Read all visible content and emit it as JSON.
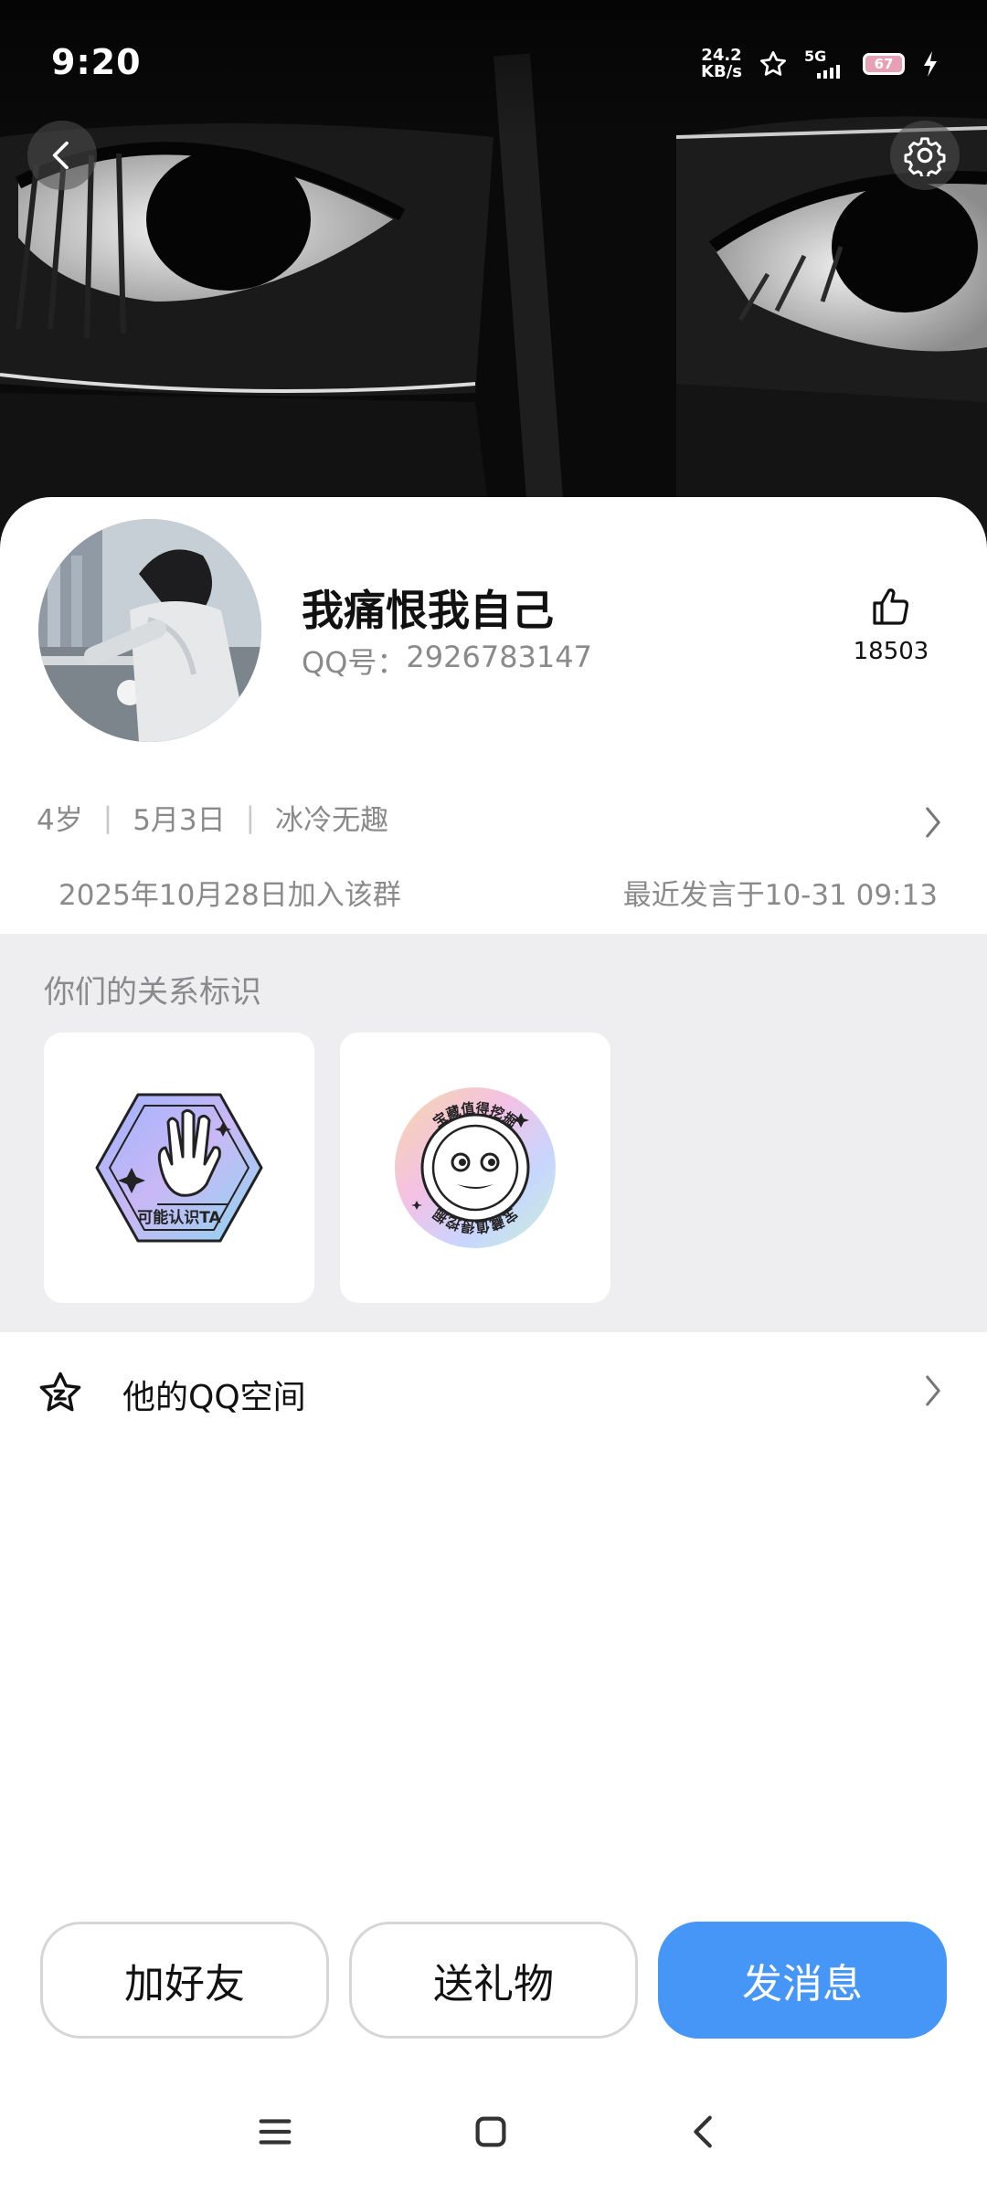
{
  "status_bar": {
    "time": "9:20",
    "net_speed_value": "24.2",
    "net_speed_unit": "KB/s",
    "network": "5G",
    "battery": "67",
    "icons": [
      "star-icon",
      "signal-icon",
      "battery-icon",
      "charging-icon"
    ]
  },
  "header": {
    "back_icon": "chevron-left-icon",
    "settings_icon": "gear-icon"
  },
  "profile": {
    "nickname": "我痛恨我自己",
    "qq_label": "QQ号：",
    "qq_number": "2926783147",
    "like_count": "18503",
    "like_icon": "thumbs-up-icon",
    "age": "4岁",
    "birthday": "5月3日",
    "signature": "冰冷无趣",
    "joined": "2025年10月28日加入该群",
    "last_speak": "最近发言于10-31 09:13"
  },
  "relation": {
    "title": "你们的关系标识",
    "badges": [
      {
        "name": "hand-wave-badge",
        "text": "可能认识TA"
      },
      {
        "name": "smiley-badge",
        "text": "宝藏值得挖掘"
      }
    ]
  },
  "zone": {
    "label": "他的QQ空间",
    "icon": "star-face-icon"
  },
  "actions": {
    "add_friend": "加好友",
    "send_gift": "送礼物",
    "send_message": "发消息"
  },
  "colors": {
    "primary": "#4696f7",
    "section_bg": "#eeeef0",
    "muted_text": "#8a8a8a"
  }
}
